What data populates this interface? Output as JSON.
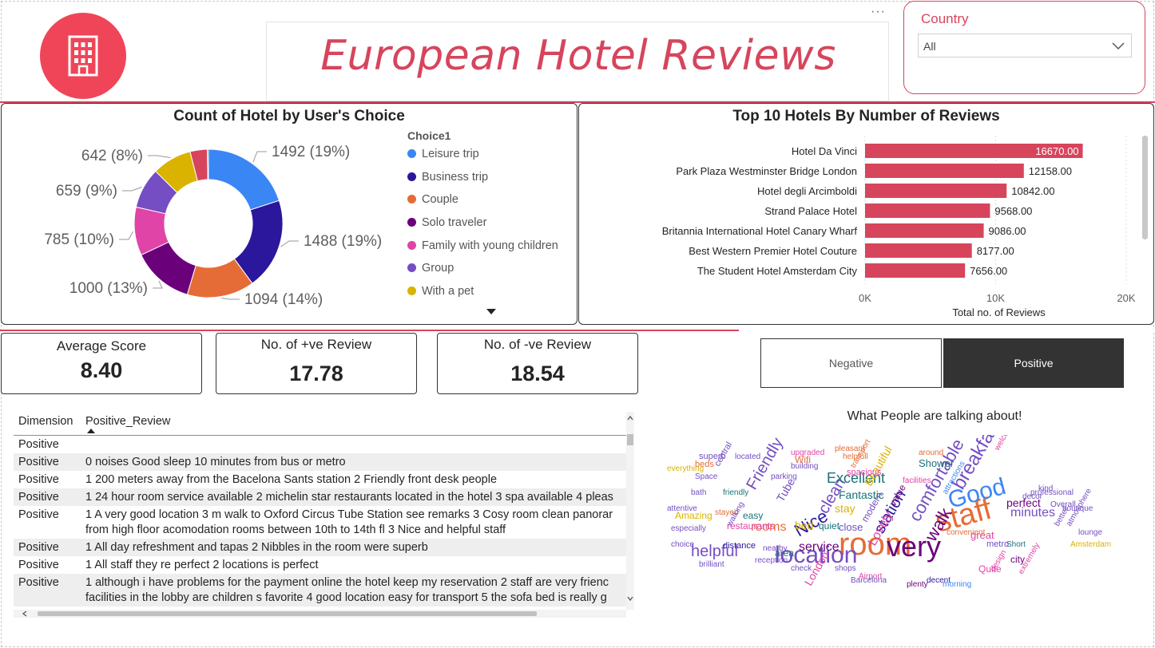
{
  "header": {
    "title": "European Hotel Reviews",
    "more_options": "···",
    "logo_icon": "building-icon",
    "accent_color": "#d6455c"
  },
  "slicer": {
    "title": "Country",
    "selected": "All"
  },
  "donut": {
    "title": "Count of Hotel by User's Choice",
    "legend_title": "Choice1",
    "legend_items": [
      {
        "label": "Leisure trip",
        "color": "#3b86f5"
      },
      {
        "label": "Business trip",
        "color": "#2a179b"
      },
      {
        "label": "Couple",
        "color": "#e66c37"
      },
      {
        "label": "Solo traveler",
        "color": "#6b007b"
      },
      {
        "label": "Family with young children",
        "color": "#e044a7"
      },
      {
        "label": "Group",
        "color": "#744ec2"
      },
      {
        "label": "With a pet",
        "color": "#d9b300"
      }
    ],
    "data_labels": [
      "1492 (19%)",
      "1488 (19%)",
      "1094 (14%)",
      "1000 (13%)",
      "785 (10%)",
      "659 (9%)",
      "642 (8%)"
    ]
  },
  "bars": {
    "title": "Top 10 Hotels By Number of Reviews",
    "axis_title": "Total no. of Reviews",
    "ticks": [
      "0K",
      "10K",
      "20K"
    ],
    "bar_color": "#d6455c"
  },
  "kpis": {
    "avg_label": "Average Score",
    "avg_value": "8.40",
    "pos_label": "No. of +ve Review",
    "pos_value": "17.78",
    "neg_label": "No. of -ve Review",
    "neg_value": "18.54"
  },
  "toggle": {
    "negative": "Negative",
    "positive": "Positive"
  },
  "table": {
    "col1": "Dimension",
    "col2": "Positive_Review",
    "rows": [
      {
        "dim": "Positive",
        "text": "",
        "text2": ""
      },
      {
        "dim": "Positive",
        "text": "0 noises Good sleep 10 minutes from bus or metro",
        "text2": ""
      },
      {
        "dim": "Positive",
        "text": "1 200 meters away from the Bacelona Sants station 2 Friendly front desk people",
        "text2": ""
      },
      {
        "dim": "Positive",
        "text": "1 24 hour room service available 2 michelin star restaurants located in the hotel 3 spa available 4 pleas",
        "text2": ""
      },
      {
        "dim": "Positive",
        "text": "1 A very good location 3 m walk to Oxford Circus Tube Station see remarks 3 Cosy room clean panorar",
        "text2": "from high floor acomodation rooms between 10th to 14th fl 3 Nice and helpful staff"
      },
      {
        "dim": "Positive",
        "text": "1 All day refreshment and tapas 2 Nibbles in the room were superb",
        "text2": ""
      },
      {
        "dim": "Positive",
        "text": "1 All staff they re perfect 2 locations is perfect",
        "text2": ""
      },
      {
        "dim": "Positive",
        "text": "1 although i have problems for the payment online the hotel keep my reservation 2 staff are very frienc",
        "text2": "facilities in the lobby are children s favorite 4 good location easy for transport 5 the sofa bed is really g"
      }
    ]
  },
  "wordcloud": {
    "title": "What People are talking about!",
    "words": [
      {
        "w": "room",
        "c": "#e66c37"
      },
      {
        "w": "very",
        "c": "#6b007b"
      },
      {
        "w": "location",
        "c": "#744ec2"
      },
      {
        "w": "staff",
        "c": "#e66c37"
      },
      {
        "w": "Good",
        "c": "#3b86f5"
      },
      {
        "w": "breakfast",
        "c": "#744ec2"
      },
      {
        "w": "comfortable",
        "c": "#744ec2"
      },
      {
        "w": "helpful",
        "c": "#744ec2"
      },
      {
        "w": "clean",
        "c": "#744ec2"
      },
      {
        "w": "Nice",
        "c": "#2a179b"
      },
      {
        "w": "walk",
        "c": "#6b007b"
      },
      {
        "w": "Friendly",
        "c": "#744ec2"
      },
      {
        "w": "station",
        "c": "#2a179b"
      },
      {
        "w": "Excellent",
        "c": "#197278"
      },
      {
        "w": "rooms",
        "c": "#e66c37"
      },
      {
        "w": "service",
        "c": "#6b007b"
      },
      {
        "w": "minutes",
        "c": "#744ec2"
      },
      {
        "w": "bed",
        "c": "#d9b300"
      },
      {
        "w": "close",
        "c": "#744ec2"
      },
      {
        "w": "stay",
        "c": "#d9b300"
      },
      {
        "w": "Lovely",
        "c": "#e044a7"
      },
      {
        "w": "perfect",
        "c": "#6b007b"
      },
      {
        "w": "restaurants",
        "c": "#e044a7"
      },
      {
        "w": "great",
        "c": "#e044a7"
      },
      {
        "w": "Amazing",
        "c": "#d9b300"
      },
      {
        "w": "easy",
        "c": "#197278"
      },
      {
        "w": "value",
        "c": "#6b007b"
      },
      {
        "w": "London",
        "c": "#e044a7"
      },
      {
        "w": "modern",
        "c": "#744ec2"
      },
      {
        "w": "Beautiful",
        "c": "#d9b300"
      },
      {
        "w": "quiet",
        "c": "#197278"
      },
      {
        "w": "Fantastic",
        "c": "#197278"
      },
      {
        "w": "city",
        "c": "#6b007b"
      },
      {
        "w": "Shower",
        "c": "#197278"
      },
      {
        "w": "Tube",
        "c": "#744ec2"
      },
      {
        "w": "Wifi",
        "c": "#e66c37"
      },
      {
        "w": "design",
        "c": "#e044a7"
      },
      {
        "w": "metro",
        "c": "#744ec2"
      },
      {
        "w": "area",
        "c": "#197278"
      },
      {
        "w": "spacious",
        "c": "#e044a7"
      },
      {
        "w": "distance",
        "c": "#2a179b"
      },
      {
        "w": "Quite",
        "c": "#e044a7"
      },
      {
        "w": "Short",
        "c": "#197278"
      },
      {
        "w": "Amsterdam",
        "c": "#d9b300"
      },
      {
        "w": "brilliant",
        "c": "#744ec2"
      },
      {
        "w": "shops",
        "c": "#744ec2"
      },
      {
        "w": "plenty",
        "c": "#6b007b"
      },
      {
        "w": "decent",
        "c": "#2a179b"
      },
      {
        "w": "morning",
        "c": "#3b86f5"
      },
      {
        "w": "convenient",
        "c": "#e66c37"
      },
      {
        "w": "Airport",
        "c": "#e044a7"
      },
      {
        "w": "especially",
        "c": "#744ec2"
      },
      {
        "w": "Barcelona",
        "c": "#744ec2"
      },
      {
        "w": "welcoming",
        "c": "#e044a7"
      },
      {
        "w": "lounge",
        "c": "#744ec2"
      },
      {
        "w": "atmosphere",
        "c": "#744ec2"
      },
      {
        "w": "Overall",
        "c": "#744ec2"
      },
      {
        "w": "boutique",
        "c": "#744ec2"
      },
      {
        "w": "professional",
        "c": "#744ec2"
      },
      {
        "w": "superb",
        "c": "#744ec2"
      },
      {
        "w": "beds",
        "c": "#e66c37"
      },
      {
        "w": "central",
        "c": "#744ec2"
      },
      {
        "w": "located",
        "c": "#744ec2"
      },
      {
        "w": "upgraded",
        "c": "#e044a7"
      },
      {
        "w": "pleasant",
        "c": "#e66c37"
      },
      {
        "w": "building",
        "c": "#744ec2"
      },
      {
        "w": "parking",
        "c": "#744ec2"
      },
      {
        "w": "stayed",
        "c": "#e66c37"
      },
      {
        "w": "walking",
        "c": "#744ec2"
      },
      {
        "w": "everything",
        "c": "#d9b300"
      },
      {
        "w": "attentive",
        "c": "#744ec2"
      },
      {
        "w": "nearby",
        "c": "#744ec2"
      },
      {
        "w": "reception",
        "c": "#744ec2"
      },
      {
        "w": "check",
        "c": "#744ec2"
      },
      {
        "w": "better",
        "c": "#744ec2"
      },
      {
        "w": "decor",
        "c": "#744ec2"
      },
      {
        "w": "kind",
        "c": "#744ec2"
      },
      {
        "w": "choice",
        "c": "#744ec2"
      },
      {
        "w": "Space",
        "c": "#744ec2"
      },
      {
        "w": "bath",
        "c": "#744ec2"
      },
      {
        "w": "friendly",
        "c": "#197278"
      },
      {
        "w": "helpfull",
        "c": "#e66c37"
      },
      {
        "w": "facilities",
        "c": "#e044a7"
      },
      {
        "w": "attractions",
        "c": "#3b86f5"
      },
      {
        "w": "around",
        "c": "#e66c37"
      },
      {
        "w": "transport",
        "c": "#e66c37"
      },
      {
        "w": "extremely",
        "c": "#e044a7"
      }
    ]
  }
}
